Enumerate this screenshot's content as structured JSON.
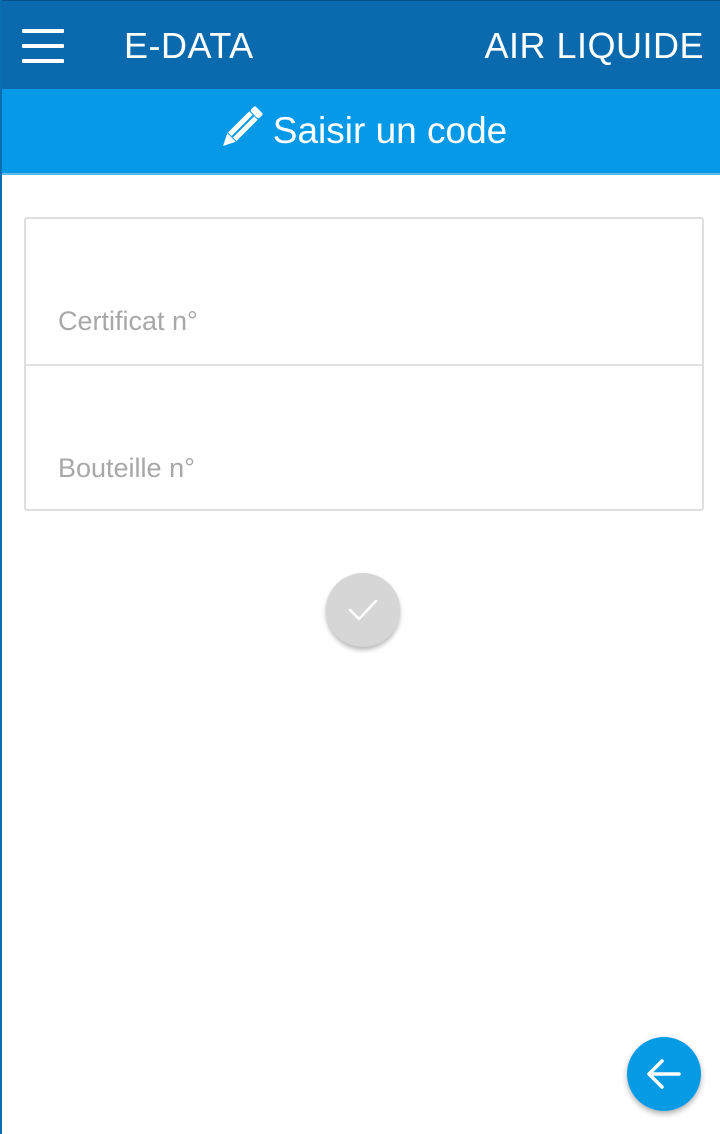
{
  "appbar": {
    "title": "E-DATA",
    "brand": "AIR LIQUIDE",
    "menu_icon": "hamburger-menu-icon"
  },
  "subheader": {
    "title": "Saisir un code",
    "icon": "pencil-icon"
  },
  "form": {
    "certificate": {
      "placeholder": "Certificat n°",
      "value": ""
    },
    "bottle": {
      "placeholder": "Bouteille n°",
      "value": ""
    }
  },
  "actions": {
    "confirm_icon": "checkmark-icon",
    "back_icon": "arrow-left-icon"
  },
  "colors": {
    "appbar": "#0b6aae",
    "subheader": "#0599e8",
    "confirm_disabled": "#d6d6d6",
    "fab": "#079be6",
    "placeholder": "#a8a8a8"
  }
}
